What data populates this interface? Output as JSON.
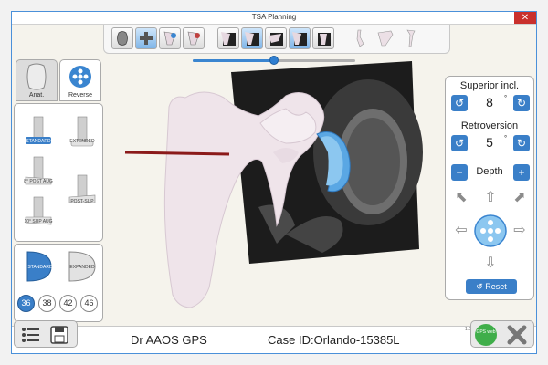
{
  "window": {
    "title": "TSA Planning",
    "close_glyph": "✕"
  },
  "toolbar": {
    "buttons": [
      {
        "icon": "glenoid-view-icon"
      },
      {
        "icon": "implant-placement-icon"
      },
      {
        "icon": "scapula-blue-icon"
      },
      {
        "icon": "scapula-red-icon"
      },
      {
        "icon": "ct-view-1-icon"
      },
      {
        "icon": "ct-view-2-icon"
      },
      {
        "icon": "ct-view-3-icon"
      },
      {
        "icon": "ct-view-4-icon"
      },
      {
        "icon": "ct-view-5-icon"
      },
      {
        "icon": "bone-posterior-icon"
      },
      {
        "icon": "bone-lateral-icon"
      },
      {
        "icon": "bone-anterior-icon"
      }
    ],
    "slider_value": 0.5
  },
  "left_panel": {
    "tabs": [
      {
        "label": "Anat.",
        "selected": true
      },
      {
        "label": "Reverse",
        "selected": false
      }
    ],
    "implants": [
      {
        "label": "STANDARD",
        "selected": true
      },
      {
        "label": "EXTENDED",
        "selected": false
      },
      {
        "label": "8° POST AUG",
        "selected": false
      },
      {
        "label": "POST-SUP",
        "selected": false
      },
      {
        "label": "10° SUP AUG",
        "selected": false
      }
    ],
    "glenospheres": [
      {
        "label": "STANDARD"
      },
      {
        "label": "EXPANDED"
      }
    ],
    "sizes": [
      "36",
      "38",
      "42",
      "46"
    ],
    "selected_size": "36"
  },
  "right_panel": {
    "superior_label": "Superior incl.",
    "superior_value": "8",
    "retroversion_label": "Retroversion",
    "retroversion_value": "5",
    "degree_symbol": "°",
    "depth_label": "Depth",
    "minus_glyph": "−",
    "plus_glyph": "+",
    "rotate_ccw_glyph": "↺",
    "rotate_cw_glyph": "↻",
    "reset_label": "Reset",
    "reset_glyph": "↺"
  },
  "status": {
    "doctor": "Dr AAOS GPS",
    "case_id": "Case ID:Orlando-15385L",
    "version": "1.0",
    "gps_web": "GPS web"
  },
  "colors": {
    "accent": "#3a7fc8",
    "bone": "#efe4ea",
    "implant": "#6fb3e8",
    "guide_wire": "#8b1a1a",
    "ct_background": "#1c1c1c"
  }
}
